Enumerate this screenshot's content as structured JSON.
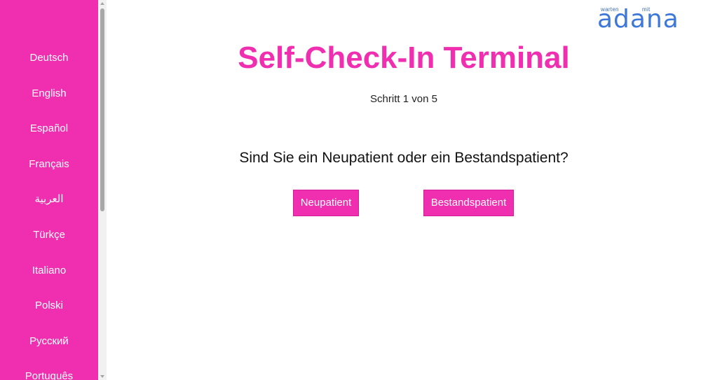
{
  "sidebar": {
    "languages": [
      {
        "label": "Deutsch"
      },
      {
        "label": "English"
      },
      {
        "label": "Español"
      },
      {
        "label": "Français"
      },
      {
        "label": "العربية"
      },
      {
        "label": "Türkçe"
      },
      {
        "label": "Italiano"
      },
      {
        "label": "Polski"
      },
      {
        "label": "Русский"
      },
      {
        "label": "Português"
      }
    ]
  },
  "logo": {
    "tag_left": "warten",
    "tag_right": "mit",
    "wordmark": "adana"
  },
  "main": {
    "title": "Self-Check-In Terminal",
    "step": "Schritt 1 von 5",
    "question": "Sind Sie ein Neupatient oder ein Bestandspatient?",
    "buttons": {
      "new_patient": "Neupatient",
      "existing_patient": "Bestandspatient"
    }
  },
  "colors": {
    "accent": "#ef2fb0",
    "logo_blue": "#3d78d8"
  }
}
